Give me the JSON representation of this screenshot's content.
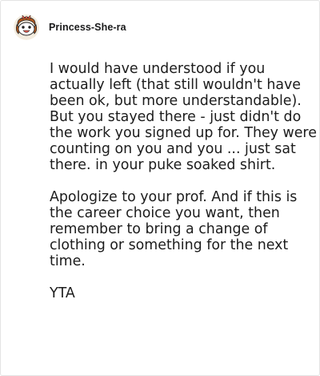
{
  "post": {
    "author": {
      "username": "Princess-She-ra",
      "avatar": {
        "icon": "snoo-avatar-icon",
        "colors": {
          "background": "#f3ecdf",
          "hair": "#b65a1f",
          "face": "#ffffff",
          "outline": "#222222",
          "mouth": "#e0584b"
        }
      }
    },
    "paragraphs": [
      "I would have understood if you actually left (that still wouldn't have been ok, but more understandable). But you stayed there - just didn't do the work you signed up for. They were counting on you and you ... just sat there. in your puke soaked shirt.",
      "Apologize to your prof. And if this is the career choice you want, then remember to bring a change of clothing or something for the next time.",
      "YTA"
    ]
  }
}
